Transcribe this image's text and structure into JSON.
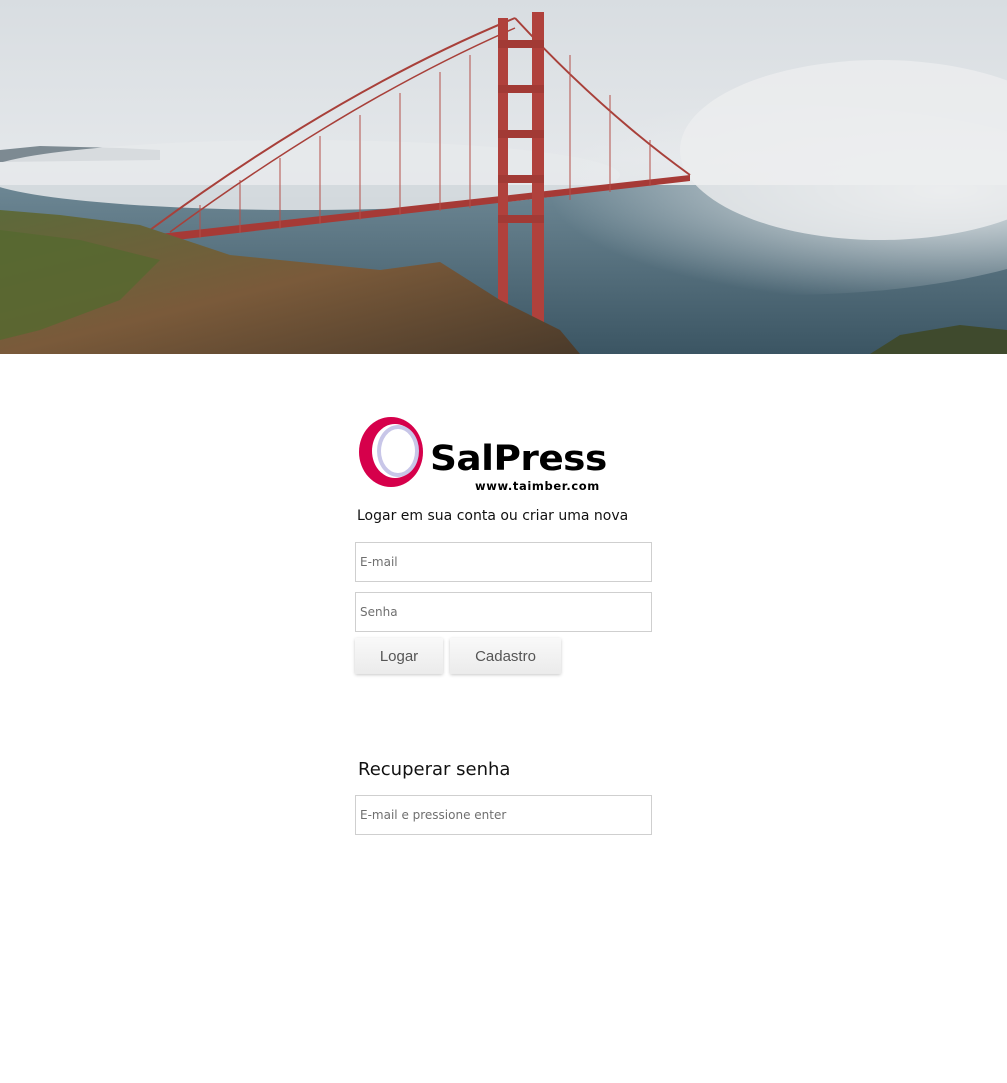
{
  "hero": {
    "icon": "golden-gate-bridge-photo"
  },
  "logo": {
    "brand": "SalPress",
    "url": "www.taimber.com",
    "colors": {
      "ring": "#d6004b",
      "inner": "#c8c6e8",
      "text": "#000000"
    }
  },
  "login": {
    "subtitle": "Logar em sua conta ou criar uma nova",
    "email_placeholder": "E-mail",
    "password_placeholder": "Senha",
    "login_button": "Logar",
    "signup_button": "Cadastro"
  },
  "recover": {
    "title": "Recuperar senha",
    "email_placeholder": "E-mail e pressione enter"
  }
}
